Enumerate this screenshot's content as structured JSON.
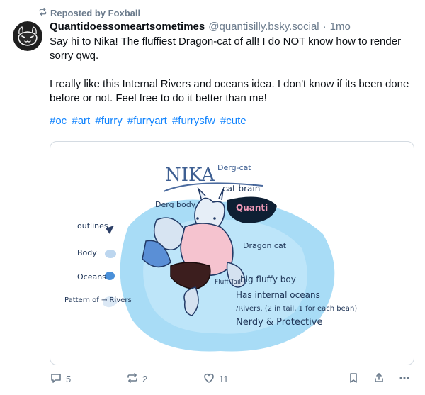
{
  "repost": {
    "label": "Reposted by Foxball"
  },
  "author": {
    "display_name": "Quantidoessomeartsometimes",
    "handle": "@quantisilly.bsky.social",
    "separator": "·",
    "time": "1mo"
  },
  "post": {
    "paragraphs": [
      "Say hi to Nika! The fluffiest Dragon-cat of all! I do NOT know how to render sorry qwq.",
      "I really like this Internal Rivers and oceans idea. I don't know if its been done before or not. Feel free to do it better than me!"
    ],
    "hashtags": [
      "#oc",
      "#art",
      "#furry",
      "#furryart",
      "#furrysfw",
      "#cute"
    ]
  },
  "artwork": {
    "title": "NIKA",
    "title_sub": "Derg-cat",
    "cat_brain": "cat brain",
    "derg_body": "Derg body",
    "quanti": "Quanti",
    "dragon_cat": "Dragon cat",
    "outlines": "outlines",
    "body": "Body",
    "oceans": "Oceans",
    "pattern": "Pattern of → Rivers",
    "fluffy_boy": "big fluffy boy",
    "internal_line1": "Has internal oceans",
    "internal_line2": "/Rivers. (2 in tail, 1 for each bean)",
    "nerdy": "Nerdy & Protective",
    "fluff_tail": "Fluff Tail"
  },
  "actions": {
    "replies": "5",
    "reposts": "2",
    "likes": "11"
  },
  "colors": {
    "accent": "#1083fe",
    "muted": "#6b7b8c",
    "border": "#d4dbe2"
  }
}
